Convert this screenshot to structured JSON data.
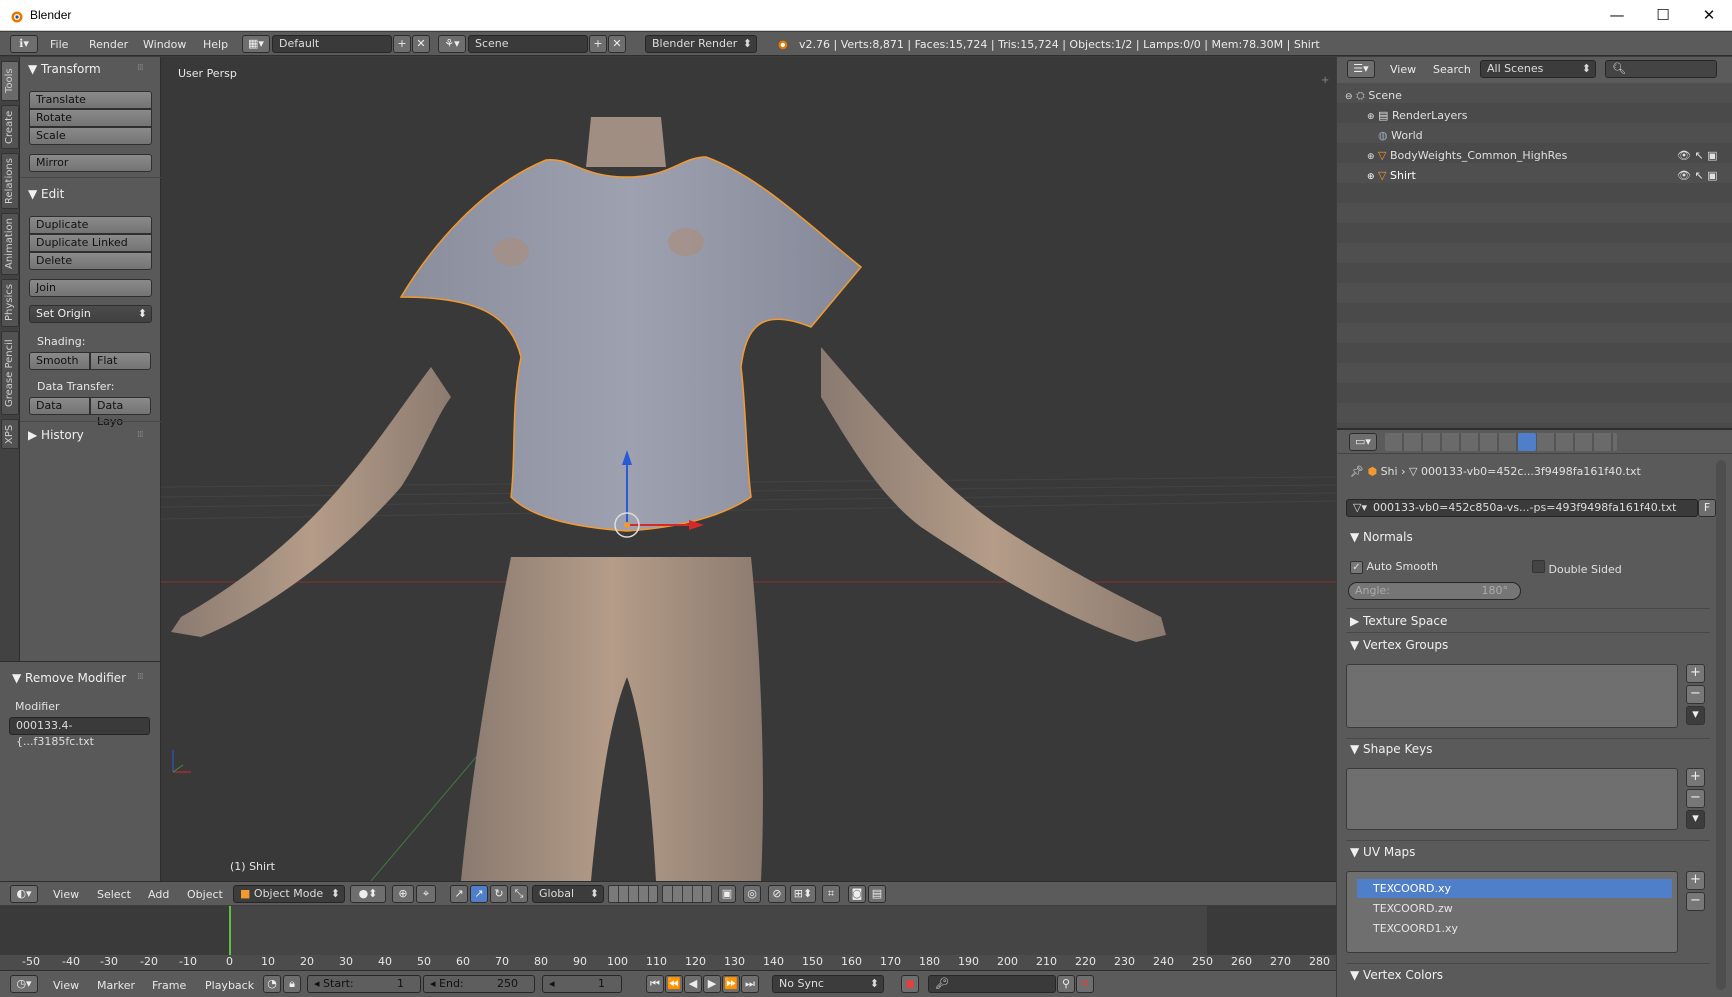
{
  "window": {
    "title": "Blender",
    "minimize": "—",
    "maximize": "☐",
    "close": "✕"
  },
  "top": {
    "menus": [
      "File",
      "Render",
      "Window",
      "Help"
    ],
    "layout": "Default",
    "scene": "Scene",
    "engine": "Blender Render",
    "stats": "v2.76 | Verts:8,871 | Faces:15,724 | Tris:15,724 | Objects:1/2 | Lamps:0/0 | Mem:78.30M | Shirt"
  },
  "tabs": [
    "Tools",
    "Create",
    "Relations",
    "Animation",
    "Physics",
    "Grease Pencil",
    "XPS"
  ],
  "toolshelf": {
    "transform": "Transform",
    "translate": "Translate",
    "rotate": "Rotate",
    "scale": "Scale",
    "mirror": "Mirror",
    "edit": "Edit",
    "duplicate": "Duplicate",
    "duplicate_linked": "Duplicate Linked",
    "delete": "Delete",
    "join": "Join",
    "set_origin": "Set Origin",
    "shading": "Shading:",
    "smooth": "Smooth",
    "flat": "Flat",
    "data_transfer": "Data Transfer:",
    "data": "Data",
    "data_layo": "Data Layo",
    "history": "History",
    "remove_modifier": "Remove Modifier",
    "modifier_label": "Modifier",
    "modifier_value": "000133.4-{...f3185fc.txt"
  },
  "viewport": {
    "view_name": "User Persp",
    "object_label": "(1) Shirt"
  },
  "view_header": {
    "menus": [
      "View",
      "Select",
      "Add",
      "Object"
    ],
    "mode": "Object Mode",
    "orientation": "Global"
  },
  "timeline": {
    "ticks": [
      "-50",
      "-40",
      "-30",
      "-20",
      "-10",
      "0",
      "10",
      "20",
      "30",
      "40",
      "50",
      "60",
      "70",
      "80",
      "90",
      "100",
      "110",
      "120",
      "130",
      "140",
      "150",
      "160",
      "170",
      "180",
      "190",
      "200",
      "210",
      "220",
      "230",
      "240",
      "250",
      "260",
      "270",
      "280"
    ],
    "menus": [
      "View",
      "Marker",
      "Frame",
      "Playback"
    ],
    "start_label": "Start:",
    "start": "1",
    "end_label": "End:",
    "end": "250",
    "current": "1",
    "sync": "No Sync"
  },
  "outliner": {
    "menus": [
      "View",
      "Search"
    ],
    "filter": "All Scenes",
    "items": [
      "Scene",
      "RenderLayers",
      "World",
      "BodyWeights_Common_HighRes",
      "Shirt"
    ]
  },
  "properties": {
    "breadcrumb_obj": "Shi",
    "breadcrumb_mesh": "000133-vb0=452c...3f9498fa161f40.txt",
    "mesh_name": "000133-vb0=452c850a-vs...-ps=493f9498fa161f40.txt",
    "fake_user": "F",
    "normals": "Normals",
    "auto_smooth": "Auto Smooth",
    "double_sided": "Double Sided",
    "angle": "Angle:",
    "angle_value": "180°",
    "texture_space": "Texture Space",
    "vertex_groups": "Vertex Groups",
    "shape_keys": "Shape Keys",
    "uv_maps": "UV Maps",
    "uv_items": [
      "TEXCOORD.xy",
      "TEXCOORD.zw",
      "TEXCOORD1.xy"
    ],
    "vertex_colors": "Vertex Colors"
  },
  "colors": {
    "selected": "#4f7fc9",
    "outline": "#f29a30",
    "timeline_cursor": "#5fbf3f"
  }
}
